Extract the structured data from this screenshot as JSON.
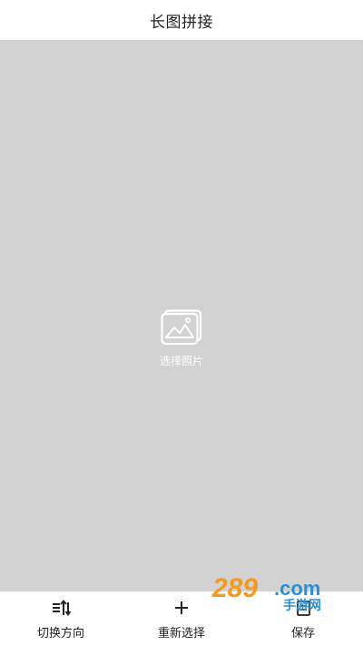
{
  "header": {
    "title": "长图拼接"
  },
  "canvas": {
    "picker_label": "选择照片",
    "picker_icon": "image-icon",
    "background_color": "#d3d2d3"
  },
  "toolbar": {
    "items": [
      {
        "label": "切换方向",
        "icon": "switch-direction-icon"
      },
      {
        "label": "重新选择",
        "icon": "plus-icon"
      },
      {
        "label": "保存",
        "icon": "save-icon"
      }
    ]
  },
  "watermark": {
    "text_main": "289",
    "text_com": ".com",
    "text_sub": "手游网",
    "colors": {
      "orange": "#f39a1e",
      "blue": "#2b8fd6"
    }
  }
}
